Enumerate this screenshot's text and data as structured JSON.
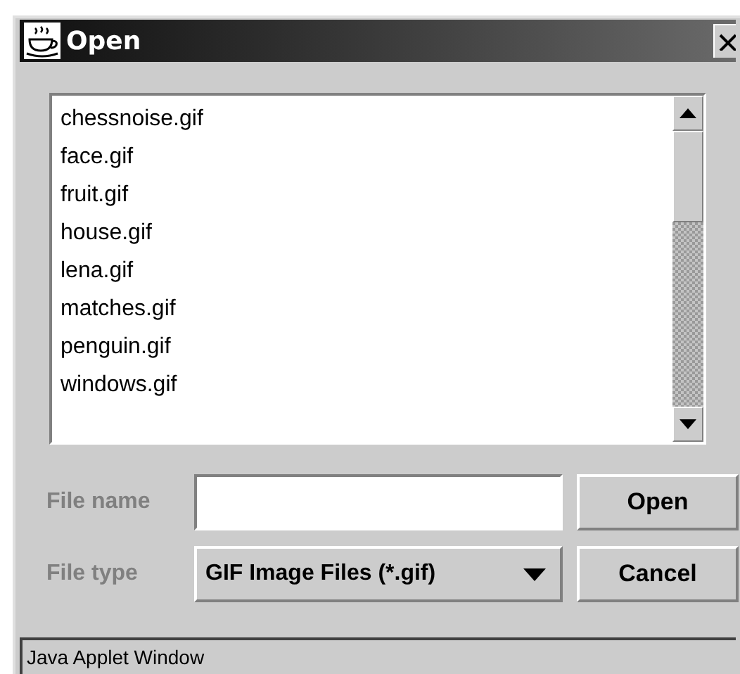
{
  "window": {
    "title": "Open"
  },
  "file_list": {
    "items": [
      {
        "name": "chessnoise.gif",
        "selected": false
      },
      {
        "name": "face.gif",
        "selected": false
      },
      {
        "name": "fruit.gif",
        "selected": false
      },
      {
        "name": "house.gif",
        "selected": false
      },
      {
        "name": "lena.gif",
        "selected": false
      },
      {
        "name": "matches.gif",
        "selected": false
      },
      {
        "name": "penguin.gif",
        "selected": false
      },
      {
        "name": "windows.gif",
        "selected": false
      }
    ]
  },
  "file_name": {
    "label": "File name"
  },
  "file_type": {
    "label": "File type",
    "value": "GIF Image Files (*.gif)"
  },
  "buttons": [
    "Open",
    "Cancel"
  ],
  "status_bar": "Java Applet Window"
}
